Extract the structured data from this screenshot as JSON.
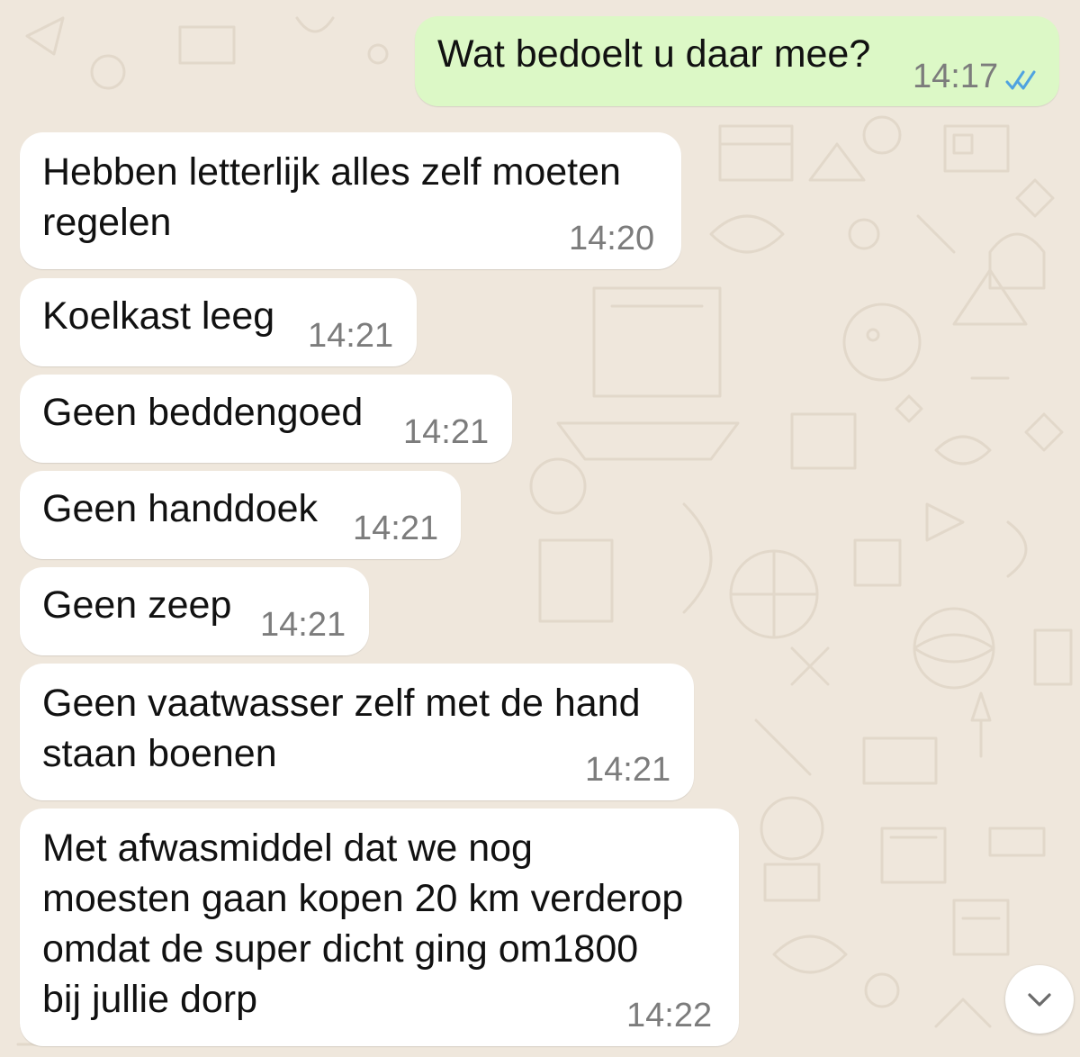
{
  "conversation": {
    "messages": [
      {
        "direction": "outgoing",
        "text": "Wat bedoelt u daar mee?",
        "time": "14:17",
        "status": "read"
      },
      {
        "direction": "incoming",
        "text": "Hebben letterlijk alles zelf moeten\nregelen",
        "time": "14:20"
      },
      {
        "direction": "incoming",
        "text": "Koelkast leeg",
        "time": "14:21"
      },
      {
        "direction": "incoming",
        "text": "Geen beddengoed",
        "time": "14:21"
      },
      {
        "direction": "incoming",
        "text": "Geen handdoek",
        "time": "14:21"
      },
      {
        "direction": "incoming",
        "text": "Geen zeep",
        "time": "14:21"
      },
      {
        "direction": "incoming",
        "text": "Geen vaatwasser zelf met de hand\nstaan boenen",
        "time": "14:21"
      },
      {
        "direction": "incoming",
        "text": "Met afwasmiddel dat we nog\nmoesten gaan kopen 20 km verderop\nomdat de super dicht ging om1800\nbij jullie dorp",
        "time": "14:22"
      }
    ]
  },
  "controls": {
    "scroll_down_icon": "chevron-down-icon"
  },
  "colors": {
    "wallpaper": "#efe7dc",
    "incoming_bubble": "#ffffff",
    "outgoing_bubble": "#dcf8c6",
    "timestamp": "#7c7c7c",
    "read_ticks": "#4fa3e0"
  }
}
